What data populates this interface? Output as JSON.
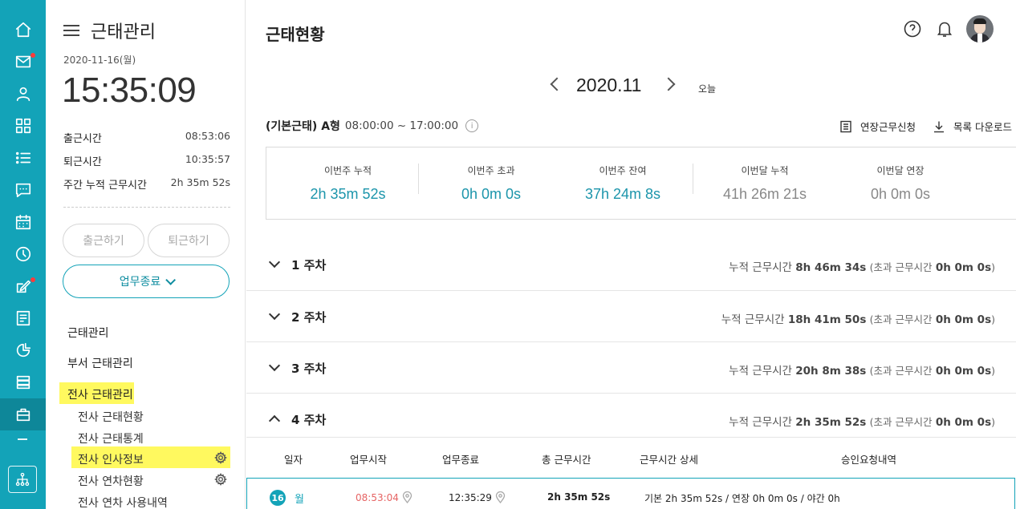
{
  "colors": {
    "accent": "#13a3b8",
    "highlight": "#fff95f",
    "alert": "#e66363"
  },
  "rail": {
    "items": [
      {
        "icon": "home-icon"
      },
      {
        "icon": "mail-icon",
        "badge": true
      },
      {
        "icon": "person-icon"
      },
      {
        "icon": "grid-icon"
      },
      {
        "icon": "list-icon"
      },
      {
        "icon": "chat-icon"
      },
      {
        "icon": "calendar-icon"
      },
      {
        "icon": "clock-icon"
      },
      {
        "icon": "edit-icon",
        "badge": true
      },
      {
        "icon": "report-icon"
      },
      {
        "icon": "pie-chart-icon"
      },
      {
        "icon": "stack-icon"
      },
      {
        "icon": "briefcase-icon",
        "active": true
      }
    ],
    "org_icon": "org-chart-icon"
  },
  "panel": {
    "title": "근태관리",
    "date": "2020-11-16(월)",
    "clock": "15:35:09",
    "stats": [
      {
        "label": "출근시간",
        "value": "08:53:06"
      },
      {
        "label": "퇴근시간",
        "value": "10:35:57"
      },
      {
        "label": "주간 누적 근무시간",
        "value": "2h 35m 52s"
      }
    ],
    "btn_checkin": "출근하기",
    "btn_checkout": "퇴근하기",
    "btn_end": "업무종료",
    "menu": [
      "근태관리",
      "부서 근태관리",
      "전사 근태관리"
    ],
    "submenu": [
      "전사 근태현황",
      "전사 근태통계",
      "전사 인사정보",
      "전사 연차현황",
      "전사 연차 사용내역"
    ]
  },
  "main": {
    "title": "근태현황",
    "month": "2020.11",
    "today": "오늘",
    "schedule_name": "(기본근태) A형",
    "schedule_time": "08:00:00 ~ 17:00:00",
    "info": "i",
    "action_overtime": "연장근무신청",
    "action_download": "목록 다운로드",
    "summary": [
      {
        "label": "이번주 누적",
        "value": "2h 35m 52s"
      },
      {
        "label": "이번주 초과",
        "value": "0h 0m 0s"
      },
      {
        "label": "이번주 잔여",
        "value": "37h 24m 8s"
      },
      {
        "label": "이번달 누적",
        "value": "41h 26m 21s"
      },
      {
        "label": "이번달 연장",
        "value": "0h 0m 0s"
      }
    ],
    "weeks": [
      {
        "name": "1 주차",
        "sum_label": "누적 근무시간",
        "sum": "8h 46m 34s",
        "over_label": "(초과 근무시간",
        "over": "0h 0m 0s",
        "close": ")"
      },
      {
        "name": "2 주차",
        "sum_label": "누적 근무시간",
        "sum": "18h 41m 50s",
        "over_label": "(초과 근무시간",
        "over": "0h 0m 0s",
        "close": ")"
      },
      {
        "name": "3 주차",
        "sum_label": "누적 근무시간",
        "sum": "20h 8m 38s",
        "over_label": "(초과 근무시간",
        "over": "0h 0m 0s",
        "close": ")"
      },
      {
        "name": "4 주차",
        "sum_label": "누적 근무시간",
        "sum": "2h 35m 52s",
        "over_label": "(초과 근무시간",
        "over": "0h 0m 0s",
        "close": ")"
      }
    ],
    "table_headers": [
      "일자",
      "업무시작",
      "업무종료",
      "총 근무시간",
      "근무시간 상세",
      "승인요청내역"
    ],
    "row": {
      "day": "16",
      "weekday": "월",
      "start": "08:53:04",
      "end": "12:35:29",
      "total": "2h 35m 52s",
      "detail": "기본 2h 35m 52s / 연장 0h 0m 0s / 야간 0h"
    }
  }
}
